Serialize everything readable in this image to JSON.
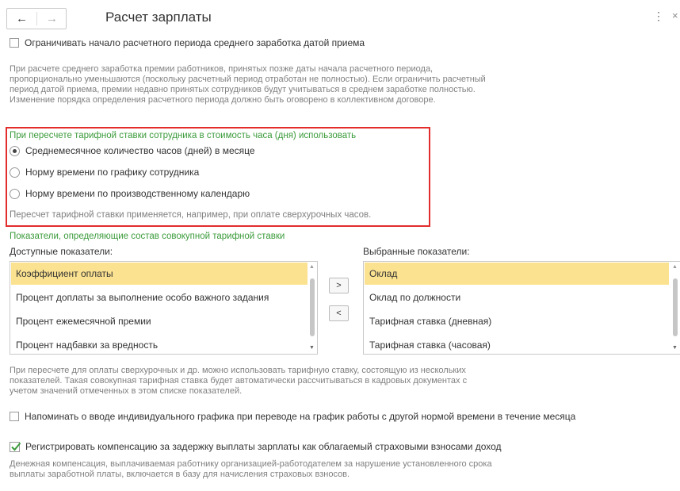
{
  "header": {
    "back_icon": "arrow-left-icon",
    "forward_icon": "arrow-right-icon",
    "title": "Расчет зарплаты",
    "more_icon": "⋮",
    "close_icon": "×"
  },
  "avg_earnings": {
    "checkbox_label": "Ограничивать начало расчетного периода среднего заработка датой приема",
    "checked": false,
    "note_lines": [
      "При расчете среднего заработка премии работников, принятых позже даты начала расчетного периода,",
      "пропорционально уменьшаются (поскольку расчетный период отработан не полностью). Если ограничить расчетный",
      "период датой приема, премии недавно принятых сотрудников будут учитываться в среднем заработке полностью.",
      "Изменение порядка определения расчетного периода должно быть оговорено в коллективном договоре."
    ]
  },
  "recalc": {
    "heading": "При пересчете тарифной ставки сотрудника в стоимость часа (дня) использовать",
    "options": [
      {
        "label": "Среднемесячное количество часов (дней) в месяце",
        "selected": true
      },
      {
        "label": "Норму времени по графику сотрудника",
        "selected": false
      },
      {
        "label": "Норму времени по производственному календарю",
        "selected": false
      }
    ],
    "note": "Пересчет тарифной ставки применяется, например, при оплате сверхурочных часов."
  },
  "indicators": {
    "heading": "Показатели, определяющие состав совокупной тарифной ставки",
    "available_label": "Доступные показатели:",
    "selected_label": "Выбранные показатели:",
    "available": [
      "Коэффициент оплаты",
      "Процент доплаты за выполнение особо важного задания",
      "Процент ежемесячной премии",
      "Процент надбавки за вредность"
    ],
    "selected": [
      "Оклад",
      "Оклад по должности",
      "Тарифная ставка (дневная)",
      "Тарифная ставка (часовая)"
    ],
    "add_button": ">",
    "remove_button": "<",
    "note_lines": [
      "При пересчете для оплаты сверхурочных и др. можно использовать тарифную ставку, состоящую из нескольких",
      "показателей. Такая совокупная тарифная ставка будет автоматически рассчитываться в кадровых документах с",
      "учетом значений отмеченных в этом списке показателей."
    ]
  },
  "individual_schedule": {
    "checkbox_label": "Напоминать о вводе индивидуального графика при переводе на график работы с другой нормой времени в течение месяца",
    "checked": false
  },
  "compensation": {
    "checkbox_label": "Регистрировать компенсацию за задержку выплаты зарплаты как облагаемый страховыми взносами доход",
    "checked": true,
    "note_lines": [
      "Денежная компенсация, выплачиваемая работнику организацией-работодателем за нарушение установленного срока",
      "выплаты заработной платы, включается в базу для начисления страховых взносов."
    ]
  },
  "colors": {
    "accent_green": "#3b9b3b",
    "highlight_frame": "#e32c2c",
    "selected_row": "#fbe291"
  }
}
